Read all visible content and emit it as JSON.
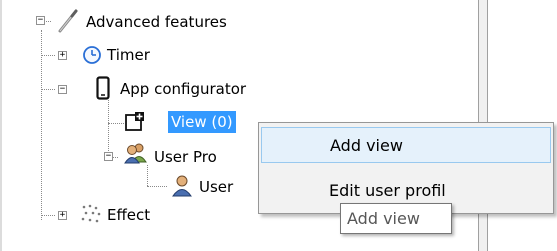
{
  "tree": {
    "nodes": [
      {
        "label": "Advanced features",
        "expander": "−"
      },
      {
        "label": "Timer",
        "expander": "+"
      },
      {
        "label": "App configurator",
        "expander": "−"
      },
      {
        "label": "View (0)"
      },
      {
        "label": "User Pro",
        "expander": "−"
      },
      {
        "label": "User"
      },
      {
        "label": "Effect",
        "expander": "+"
      }
    ]
  },
  "context_menu": {
    "items": [
      {
        "label": "Add view"
      },
      {
        "label": "Edit user profil"
      }
    ]
  },
  "tooltip": {
    "text": "Add view"
  },
  "colors": {
    "selection": "#3399ff",
    "menu_hover": "#e5f1fb",
    "menu_hover_border": "#99c9ef"
  }
}
